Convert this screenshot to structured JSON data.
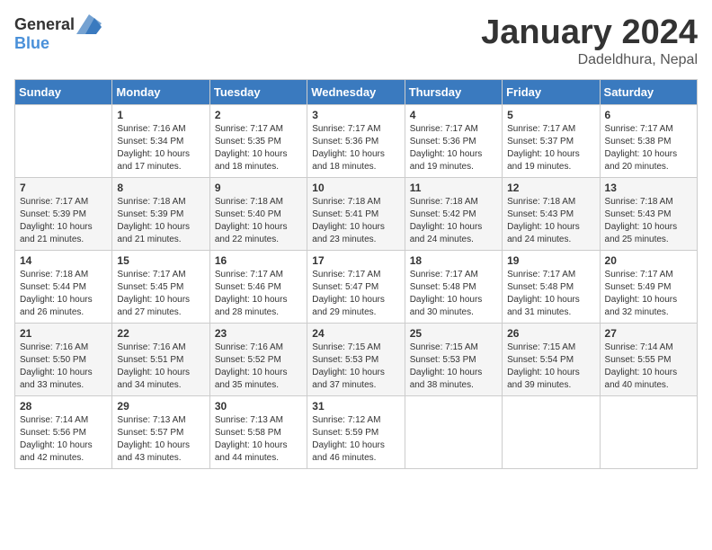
{
  "header": {
    "logo_general": "General",
    "logo_blue": "Blue",
    "month": "January 2024",
    "location": "Dadeldhura, Nepal"
  },
  "weekdays": [
    "Sunday",
    "Monday",
    "Tuesday",
    "Wednesday",
    "Thursday",
    "Friday",
    "Saturday"
  ],
  "weeks": [
    [
      {
        "day": "",
        "sunrise": "",
        "sunset": "",
        "daylight": ""
      },
      {
        "day": "1",
        "sunrise": "Sunrise: 7:16 AM",
        "sunset": "Sunset: 5:34 PM",
        "daylight": "Daylight: 10 hours and 17 minutes."
      },
      {
        "day": "2",
        "sunrise": "Sunrise: 7:17 AM",
        "sunset": "Sunset: 5:35 PM",
        "daylight": "Daylight: 10 hours and 18 minutes."
      },
      {
        "day": "3",
        "sunrise": "Sunrise: 7:17 AM",
        "sunset": "Sunset: 5:36 PM",
        "daylight": "Daylight: 10 hours and 18 minutes."
      },
      {
        "day": "4",
        "sunrise": "Sunrise: 7:17 AM",
        "sunset": "Sunset: 5:36 PM",
        "daylight": "Daylight: 10 hours and 19 minutes."
      },
      {
        "day": "5",
        "sunrise": "Sunrise: 7:17 AM",
        "sunset": "Sunset: 5:37 PM",
        "daylight": "Daylight: 10 hours and 19 minutes."
      },
      {
        "day": "6",
        "sunrise": "Sunrise: 7:17 AM",
        "sunset": "Sunset: 5:38 PM",
        "daylight": "Daylight: 10 hours and 20 minutes."
      }
    ],
    [
      {
        "day": "7",
        "sunrise": "Sunrise: 7:17 AM",
        "sunset": "Sunset: 5:39 PM",
        "daylight": "Daylight: 10 hours and 21 minutes."
      },
      {
        "day": "8",
        "sunrise": "Sunrise: 7:18 AM",
        "sunset": "Sunset: 5:39 PM",
        "daylight": "Daylight: 10 hours and 21 minutes."
      },
      {
        "day": "9",
        "sunrise": "Sunrise: 7:18 AM",
        "sunset": "Sunset: 5:40 PM",
        "daylight": "Daylight: 10 hours and 22 minutes."
      },
      {
        "day": "10",
        "sunrise": "Sunrise: 7:18 AM",
        "sunset": "Sunset: 5:41 PM",
        "daylight": "Daylight: 10 hours and 23 minutes."
      },
      {
        "day": "11",
        "sunrise": "Sunrise: 7:18 AM",
        "sunset": "Sunset: 5:42 PM",
        "daylight": "Daylight: 10 hours and 24 minutes."
      },
      {
        "day": "12",
        "sunrise": "Sunrise: 7:18 AM",
        "sunset": "Sunset: 5:43 PM",
        "daylight": "Daylight: 10 hours and 24 minutes."
      },
      {
        "day": "13",
        "sunrise": "Sunrise: 7:18 AM",
        "sunset": "Sunset: 5:43 PM",
        "daylight": "Daylight: 10 hours and 25 minutes."
      }
    ],
    [
      {
        "day": "14",
        "sunrise": "Sunrise: 7:18 AM",
        "sunset": "Sunset: 5:44 PM",
        "daylight": "Daylight: 10 hours and 26 minutes."
      },
      {
        "day": "15",
        "sunrise": "Sunrise: 7:17 AM",
        "sunset": "Sunset: 5:45 PM",
        "daylight": "Daylight: 10 hours and 27 minutes."
      },
      {
        "day": "16",
        "sunrise": "Sunrise: 7:17 AM",
        "sunset": "Sunset: 5:46 PM",
        "daylight": "Daylight: 10 hours and 28 minutes."
      },
      {
        "day": "17",
        "sunrise": "Sunrise: 7:17 AM",
        "sunset": "Sunset: 5:47 PM",
        "daylight": "Daylight: 10 hours and 29 minutes."
      },
      {
        "day": "18",
        "sunrise": "Sunrise: 7:17 AM",
        "sunset": "Sunset: 5:48 PM",
        "daylight": "Daylight: 10 hours and 30 minutes."
      },
      {
        "day": "19",
        "sunrise": "Sunrise: 7:17 AM",
        "sunset": "Sunset: 5:48 PM",
        "daylight": "Daylight: 10 hours and 31 minutes."
      },
      {
        "day": "20",
        "sunrise": "Sunrise: 7:17 AM",
        "sunset": "Sunset: 5:49 PM",
        "daylight": "Daylight: 10 hours and 32 minutes."
      }
    ],
    [
      {
        "day": "21",
        "sunrise": "Sunrise: 7:16 AM",
        "sunset": "Sunset: 5:50 PM",
        "daylight": "Daylight: 10 hours and 33 minutes."
      },
      {
        "day": "22",
        "sunrise": "Sunrise: 7:16 AM",
        "sunset": "Sunset: 5:51 PM",
        "daylight": "Daylight: 10 hours and 34 minutes."
      },
      {
        "day": "23",
        "sunrise": "Sunrise: 7:16 AM",
        "sunset": "Sunset: 5:52 PM",
        "daylight": "Daylight: 10 hours and 35 minutes."
      },
      {
        "day": "24",
        "sunrise": "Sunrise: 7:15 AM",
        "sunset": "Sunset: 5:53 PM",
        "daylight": "Daylight: 10 hours and 37 minutes."
      },
      {
        "day": "25",
        "sunrise": "Sunrise: 7:15 AM",
        "sunset": "Sunset: 5:53 PM",
        "daylight": "Daylight: 10 hours and 38 minutes."
      },
      {
        "day": "26",
        "sunrise": "Sunrise: 7:15 AM",
        "sunset": "Sunset: 5:54 PM",
        "daylight": "Daylight: 10 hours and 39 minutes."
      },
      {
        "day": "27",
        "sunrise": "Sunrise: 7:14 AM",
        "sunset": "Sunset: 5:55 PM",
        "daylight": "Daylight: 10 hours and 40 minutes."
      }
    ],
    [
      {
        "day": "28",
        "sunrise": "Sunrise: 7:14 AM",
        "sunset": "Sunset: 5:56 PM",
        "daylight": "Daylight: 10 hours and 42 minutes."
      },
      {
        "day": "29",
        "sunrise": "Sunrise: 7:13 AM",
        "sunset": "Sunset: 5:57 PM",
        "daylight": "Daylight: 10 hours and 43 minutes."
      },
      {
        "day": "30",
        "sunrise": "Sunrise: 7:13 AM",
        "sunset": "Sunset: 5:58 PM",
        "daylight": "Daylight: 10 hours and 44 minutes."
      },
      {
        "day": "31",
        "sunrise": "Sunrise: 7:12 AM",
        "sunset": "Sunset: 5:59 PM",
        "daylight": "Daylight: 10 hours and 46 minutes."
      },
      {
        "day": "",
        "sunrise": "",
        "sunset": "",
        "daylight": ""
      },
      {
        "day": "",
        "sunrise": "",
        "sunset": "",
        "daylight": ""
      },
      {
        "day": "",
        "sunrise": "",
        "sunset": "",
        "daylight": ""
      }
    ]
  ]
}
